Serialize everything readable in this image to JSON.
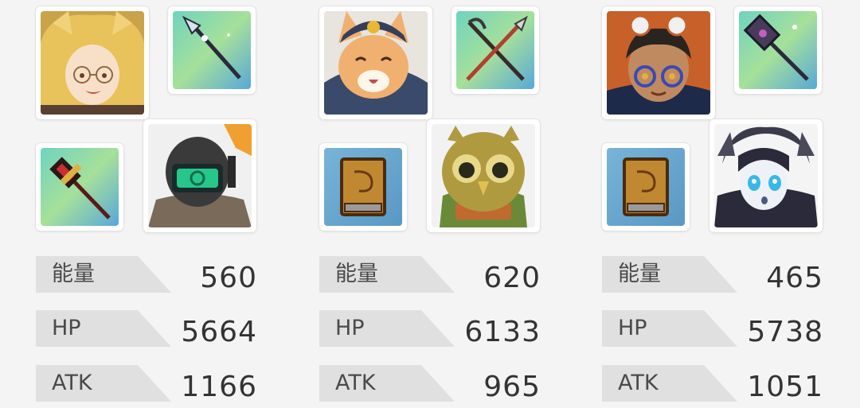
{
  "teams": [
    {
      "characters": [
        {
          "icon": "fox-girl-glasses-portrait"
        },
        {
          "icon": "green-visor-helmet-soldier-portrait"
        }
      ],
      "weapons": [
        {
          "icon": "sparkle-spear-icon"
        },
        {
          "icon": "red-hammer-icon"
        }
      ],
      "stats": [
        {
          "label": "能量",
          "value": "560"
        },
        {
          "label": "HP",
          "value": "5664"
        },
        {
          "label": "ATK",
          "value": "1166"
        }
      ]
    },
    {
      "characters": [
        {
          "icon": "cat-captain-portrait"
        },
        {
          "icon": "owl-portrait"
        }
      ],
      "weapons": [
        {
          "icon": "crossed-spears-icon"
        },
        {
          "icon": "golden-book-icon"
        }
      ],
      "stats": [
        {
          "label": "能量",
          "value": "620"
        },
        {
          "label": "HP",
          "value": "6133"
        },
        {
          "label": "ATK",
          "value": "965"
        }
      ]
    },
    {
      "characters": [
        {
          "icon": "goggles-boy-portrait"
        },
        {
          "icon": "blue-eyed-android-girl-portrait"
        }
      ],
      "weapons": [
        {
          "icon": "dark-mace-icon"
        },
        {
          "icon": "golden-book-icon"
        }
      ],
      "stats": [
        {
          "label": "能量",
          "value": "465"
        },
        {
          "label": "HP",
          "value": "5738"
        },
        {
          "label": "ATK",
          "value": "1051"
        }
      ]
    }
  ]
}
